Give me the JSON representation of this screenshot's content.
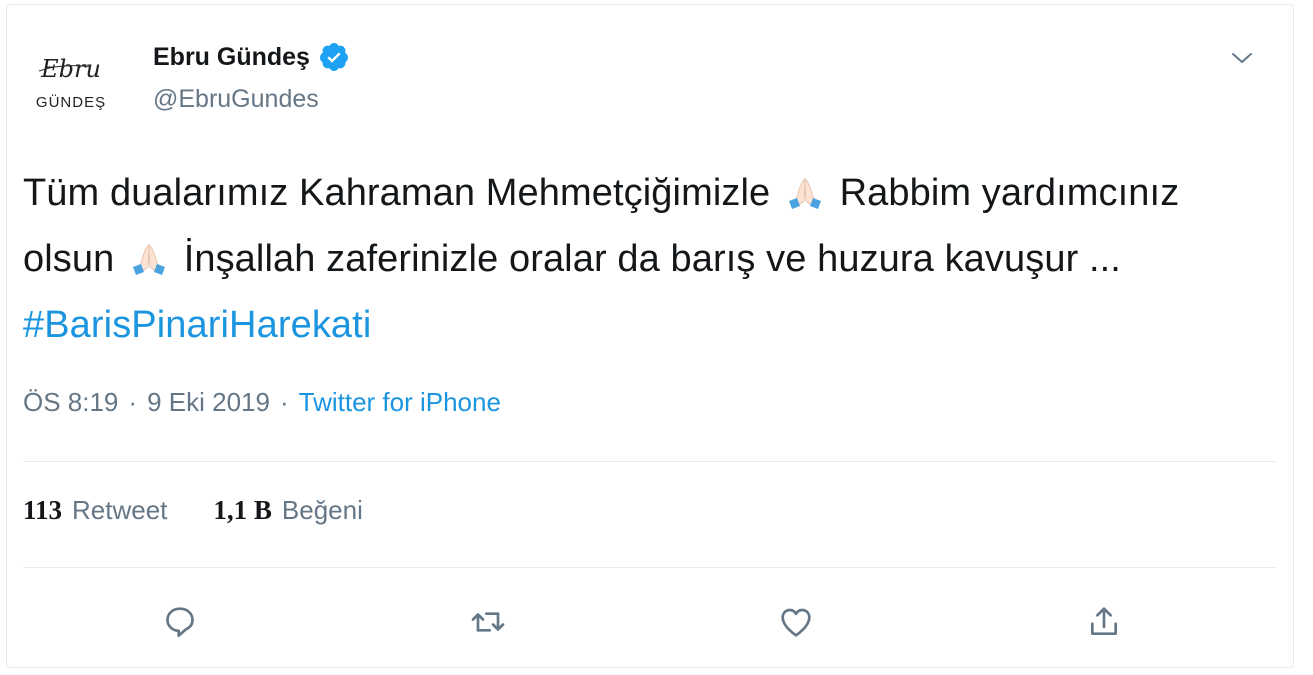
{
  "user": {
    "display_name": "Ebru Gündeş",
    "handle": "@EbruGundes",
    "avatar_logo_text": [
      "Ebru",
      "GÜNDEŞ"
    ]
  },
  "tweet": {
    "text_part1": "Tüm dualarımız Kahraman Mehmetçiğimizle",
    "text_part2": "Rabbim yardımcınız olsun",
    "text_part3": "İnşallah zaferinizle oralar da barış ve huzura kavuşur ...",
    "hashtag": "#BarisPinariHarekati",
    "emoji": "folded-hands"
  },
  "meta": {
    "time": "ÖS 8:19",
    "separator": "·",
    "date": "9 Eki 2019",
    "source": "Twitter for iPhone"
  },
  "stats": {
    "retweet_count": "113",
    "retweet_label": "Retweet",
    "like_count": "1,1 B",
    "like_label": "Beğeni"
  },
  "icons": {
    "verified": "verified-badge-icon",
    "menu": "chevron-down-icon",
    "reply": "reply-icon",
    "retweet": "retweet-icon",
    "like": "heart-icon",
    "share": "share-icon"
  },
  "colors": {
    "link": "#1b95e0",
    "muted": "#657786",
    "text": "#14171a",
    "verified": "#1da1f2",
    "divider": "#e6ecf0"
  }
}
